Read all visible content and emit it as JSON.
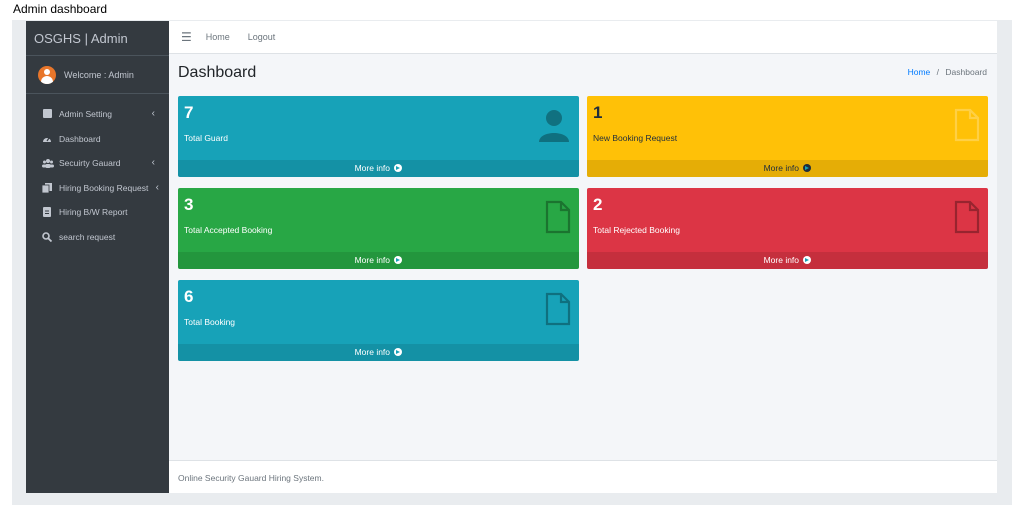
{
  "caption": "Admin dashboard",
  "colors": {
    "info": "#17a2b8",
    "warning": "#ffc107",
    "success": "#28a745",
    "danger": "#dc3545",
    "sidebar": "#343a40"
  },
  "sidebar": {
    "brand": "OSGHS | Admin",
    "welcome": "Welcome : Admin",
    "items": [
      {
        "label": "Admin Setting",
        "icon": "plus-square-icon",
        "has_arrow": true
      },
      {
        "label": "Dashboard",
        "icon": "tachometer-icon",
        "has_arrow": false
      },
      {
        "label": "Secuirty Gauard",
        "icon": "users-icon",
        "has_arrow": true
      },
      {
        "label": "Hiring Booking Request",
        "icon": "copy-icon",
        "has_arrow": true
      },
      {
        "label": "Hiring B/W Report",
        "icon": "file-icon",
        "has_arrow": false
      },
      {
        "label": "search request",
        "icon": "search-icon",
        "has_arrow": false
      }
    ],
    "arrow_glyph": "‹"
  },
  "topbar": {
    "menu_icon": "bars-icon",
    "home": "Home",
    "logout": "Logout"
  },
  "main": {
    "title": "Dashboard",
    "breadcrumb": {
      "home": "Home",
      "separator": "/",
      "current": "Dashboard"
    },
    "boxes": [
      {
        "number": "7",
        "label": "Total Guard",
        "color": "info",
        "icon": "user-icon",
        "more": "More info"
      },
      {
        "number": "1",
        "label": "New Booking Request",
        "color": "warning",
        "icon": "file-icon",
        "more": "More info"
      },
      {
        "number": "3",
        "label": "Total Accepted Booking",
        "color": "success",
        "icon": "file-icon",
        "more": "More info"
      },
      {
        "number": "2",
        "label": "Total Rejected Booking",
        "color": "danger",
        "icon": "file-icon",
        "more": "More info"
      },
      {
        "number": "6",
        "label": "Total Booking",
        "color": "info",
        "icon": "file-icon",
        "more": "More info"
      }
    ]
  },
  "footer": {
    "text": "Online Security Gauard Hiring System."
  }
}
